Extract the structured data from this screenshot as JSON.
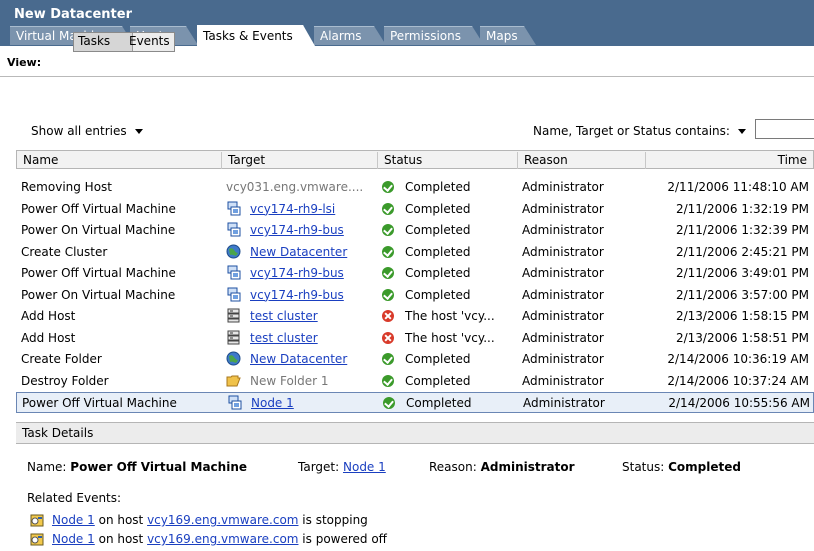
{
  "window": {
    "title": "New Datacenter"
  },
  "tabs": [
    "Virtual Machines",
    "Hosts",
    "Tasks & Events",
    "Alarms",
    "Permissions",
    "Maps"
  ],
  "view": {
    "label": "View:",
    "tasks_label": "Tasks",
    "events_label": "Events"
  },
  "filter": {
    "show_all": "Show all entries",
    "contains_label": "Name, Target or Status contains:",
    "input_value": ""
  },
  "columns": [
    "Name",
    "Target",
    "Status",
    "Reason",
    "Time"
  ],
  "rows": [
    {
      "name": "Removing Host",
      "target": "vcy031.eng.vmware....",
      "target_icon": "none",
      "status": "Completed",
      "status_icon": "success-icon",
      "reason": "Administrator",
      "time": "2/11/2006 11:48:10 AM"
    },
    {
      "name": "Power Off Virtual Machine",
      "target": "vcy174-rh9-lsi",
      "target_icon": "vm-icon",
      "status": "Completed",
      "status_icon": "success-icon",
      "reason": "Administrator",
      "time": "2/11/2006 1:32:19 PM"
    },
    {
      "name": "Power On Virtual Machine",
      "target": "vcy174-rh9-bus",
      "target_icon": "vm-icon",
      "status": "Completed",
      "status_icon": "success-icon",
      "reason": "Administrator",
      "time": "2/11/2006 1:32:39 PM"
    },
    {
      "name": "Create Cluster",
      "target": "New Datacenter",
      "target_icon": "datacenter-icon",
      "status": "Completed",
      "status_icon": "success-icon",
      "reason": "Administrator",
      "time": "2/11/2006 2:45:21 PM"
    },
    {
      "name": "Power Off Virtual Machine",
      "target": "vcy174-rh9-bus",
      "target_icon": "vm-icon",
      "status": "Completed",
      "status_icon": "success-icon",
      "reason": "Administrator",
      "time": "2/11/2006 3:49:01 PM"
    },
    {
      "name": "Power On Virtual Machine",
      "target": "vcy174-rh9-bus",
      "target_icon": "vm-icon",
      "status": "Completed",
      "status_icon": "success-icon",
      "reason": "Administrator",
      "time": "2/11/2006 3:57:00 PM"
    },
    {
      "name": "Add Host",
      "target": "test cluster",
      "target_icon": "cluster-icon",
      "status": "The host 'vcy...",
      "status_icon": "error-icon",
      "reason": "Administrator",
      "time": "2/13/2006 1:58:15 PM"
    },
    {
      "name": "Add Host",
      "target": "test cluster",
      "target_icon": "cluster-icon",
      "status": "The host 'vcy...",
      "status_icon": "error-icon",
      "reason": "Administrator",
      "time": "2/13/2006 1:58:51 PM"
    },
    {
      "name": "Create Folder",
      "target": "New Datacenter",
      "target_icon": "datacenter-icon",
      "status": "Completed",
      "status_icon": "success-icon",
      "reason": "Administrator",
      "time": "2/14/2006 10:36:19 AM"
    },
    {
      "name": "Destroy Folder",
      "target": "New Folder 1",
      "target_icon": "folder-icon",
      "status": "Completed",
      "status_icon": "success-icon",
      "reason": "Administrator",
      "time": "2/14/2006 10:37:24 AM"
    },
    {
      "name": "Power Off Virtual Machine",
      "target": "Node 1",
      "target_icon": "vm-icon",
      "status": "Completed",
      "status_icon": "success-icon",
      "reason": "Administrator",
      "time": "2/14/2006 10:55:56 AM"
    }
  ],
  "details": {
    "header": "Task Details",
    "name_label": "Name:",
    "name_value": "Power Off Virtual Machine",
    "target_label": "Target:",
    "target_value": "Node 1",
    "reason_label": "Reason:",
    "reason_value": "Administrator",
    "status_label": "Status:",
    "status_value": "Completed",
    "related_label": "Related Events:",
    "events": [
      {
        "vm": "Node 1",
        "mid": " on host ",
        "host": "vcy169.eng.vmware.com",
        "tail": " is stopping"
      },
      {
        "vm": "Node 1",
        "mid": " on host ",
        "host": "vcy169.eng.vmware.com",
        "tail": " is powered off"
      }
    ]
  }
}
